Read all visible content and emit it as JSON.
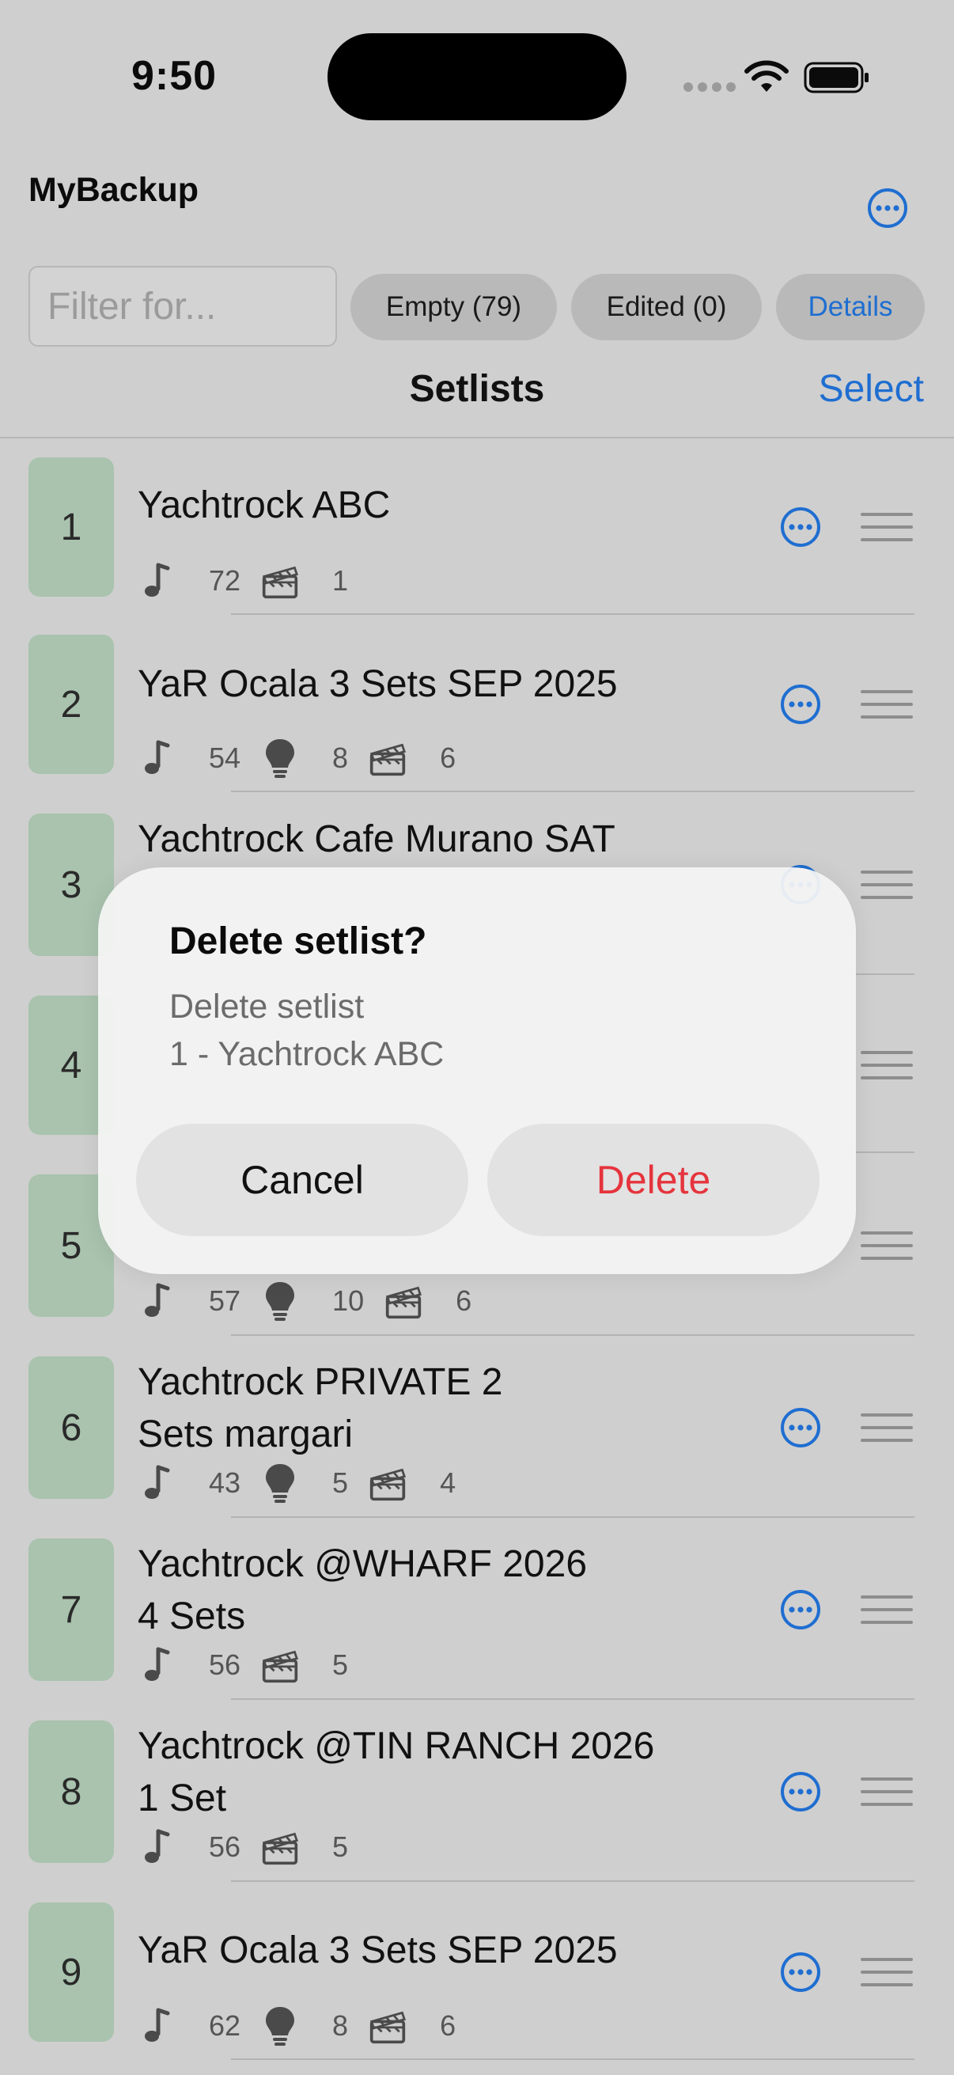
{
  "status_bar": {
    "time": "9:50"
  },
  "header": {
    "app_title": "MyBackup",
    "filter_placeholder": "Filter for...",
    "pills": {
      "empty": "Empty (79)",
      "edited": "Edited (0)",
      "details": "Details"
    },
    "nav_title": "Setlists",
    "select_label": "Select"
  },
  "setlists": [
    {
      "number": "1",
      "title": "Yachtrock ABC",
      "meta": [
        {
          "icon": "music-note-icon",
          "value": "72"
        },
        {
          "icon": "clapperboard-icon",
          "value": "1"
        }
      ]
    },
    {
      "number": "2",
      "title": "YaR Ocala 3 Sets SEP 2025",
      "meta": [
        {
          "icon": "music-note-icon",
          "value": "54"
        },
        {
          "icon": "lightbulb-icon",
          "value": "8"
        },
        {
          "icon": "clapperboard-icon",
          "value": "6"
        }
      ]
    },
    {
      "number": "3",
      "title": "Yachtrock Cafe Murano SAT"
    },
    {
      "number": "4"
    },
    {
      "number": "5",
      "meta": [
        {
          "icon": "music-note-icon",
          "value": "57"
        },
        {
          "icon": "lightbulb-icon",
          "value": "10"
        },
        {
          "icon": "clapperboard-icon",
          "value": "6"
        }
      ]
    },
    {
      "number": "6",
      "title_line1": "Yachtrock PRIVATE 2",
      "title_line2": "Sets margari",
      "meta": [
        {
          "icon": "music-note-icon",
          "value": "43"
        },
        {
          "icon": "lightbulb-icon",
          "value": "5"
        },
        {
          "icon": "clapperboard-icon",
          "value": "4"
        }
      ]
    },
    {
      "number": "7",
      "title_line1": "Yachtrock @WHARF 2026",
      "title_line2": "4 Sets",
      "meta": [
        {
          "icon": "music-note-icon",
          "value": "56"
        },
        {
          "icon": "clapperboard-icon",
          "value": "5"
        }
      ]
    },
    {
      "number": "8",
      "title_line1": "Yachtrock @TIN RANCH 2026",
      "title_line2": "1 Set",
      "meta": [
        {
          "icon": "music-note-icon",
          "value": "56"
        },
        {
          "icon": "clapperboard-icon",
          "value": "5"
        }
      ]
    },
    {
      "number": "9",
      "title": "YaR Ocala 3 Sets SEP 2025",
      "meta": [
        {
          "icon": "music-note-icon",
          "value": "62"
        },
        {
          "icon": "lightbulb-icon",
          "value": "8"
        },
        {
          "icon": "clapperboard-icon",
          "value": "6"
        }
      ]
    }
  ],
  "dialog": {
    "title": "Delete setlist?",
    "message_line1": "Delete setlist",
    "message_line2": "1 - Yachtrock ABC",
    "cancel_label": "Cancel",
    "delete_label": "Delete"
  },
  "colors": {
    "accent": "#1f6ed1",
    "badge": "#a9c3ae",
    "destructive": "#e5343d"
  }
}
